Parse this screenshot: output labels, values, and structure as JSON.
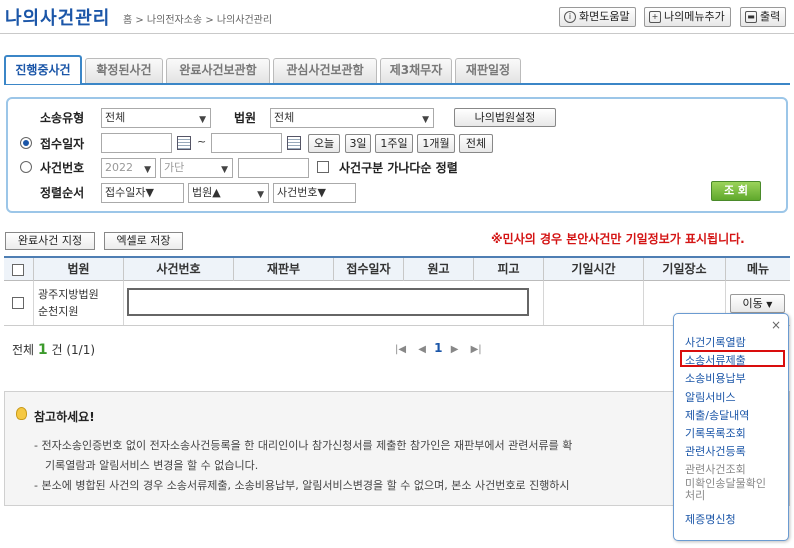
{
  "header": {
    "title": "나의사건관리",
    "breadcrumb": "홈 > 나의전자소송 > 나의사건관리",
    "buttons": {
      "help": "화면도움말",
      "add_menu": "나의메뉴추가",
      "print": "출력"
    }
  },
  "tabs": [
    {
      "label": "진행중사건",
      "active": true
    },
    {
      "label": "확정된사건"
    },
    {
      "label": "완료사건보관함"
    },
    {
      "label": "관심사건보관함"
    },
    {
      "label": "제3채무자"
    },
    {
      "label": "재판일정"
    }
  ],
  "search": {
    "labels": {
      "lawsuit_type": "소송유형",
      "court": "법원",
      "receipt_date": "접수일자",
      "case_number": "사건번호",
      "sort_order": "정렬순서"
    },
    "lawsuit_type": "전체",
    "court": "전체",
    "my_court_button": "나의법원설정",
    "date_tilde": "~",
    "range_buttons": [
      "오늘",
      "3일",
      "1주일",
      "1개월",
      "전체"
    ],
    "year": "2022",
    "case_kind": "가단",
    "case_sort_check_label": "사건구분 가나다순 정렬",
    "sort1": "접수일자▼",
    "sort2": "법원▲",
    "sort3": "사건번호▼",
    "search_button": "조 회"
  },
  "toolbar": {
    "complete_button": "완료사건 지정",
    "excel_button": "엑셀로 저장",
    "notice": "※민사의 경우 본안사건만 기일정보가 표시됩니다."
  },
  "table": {
    "headers": [
      "법원",
      "사건번호",
      "재판부",
      "접수일자",
      "원고",
      "피고",
      "기일시간",
      "기일장소",
      "메뉴"
    ],
    "row": {
      "court_line1": "광주지방법원",
      "court_line2": "순천지원",
      "menu_button": "이동"
    }
  },
  "footer": {
    "total_prefix": "전체",
    "total_count": "1",
    "total_suffix": "건 (1/1)",
    "current_page": "1"
  },
  "info": {
    "title": "참고하세요!",
    "lines": [
      "- 전자소송인증번호 없이 전자소송사건등록을 한 대리인이나 참가신청서를 제출한 참가인은 재판부에서 관련서류를 확",
      "기록열람과 알림서비스 변경을 할 수 없습니다.",
      "- 본소에 병합된 사건의 경우 소송서류제출, 소송비용납부, 알림서비스변경을 할 수 없으며, 본소 사건번호로 진행하시"
    ]
  },
  "dropdown": {
    "close": "×",
    "items": [
      "사건기록열람",
      "소송서류제출",
      "소송비용납부",
      "알림서비스",
      "제출/송달내역",
      "기록목록조회",
      "관련사건등록",
      "관련사건조회",
      "미확인송달물확인처리",
      "제증명신청"
    ],
    "highlighted": "소송서류제출"
  },
  "colors": {
    "accent": "#1b56a8",
    "notice": "#d41414",
    "highlight_box": "#d90d0d",
    "search_button": "#5fa82c"
  }
}
